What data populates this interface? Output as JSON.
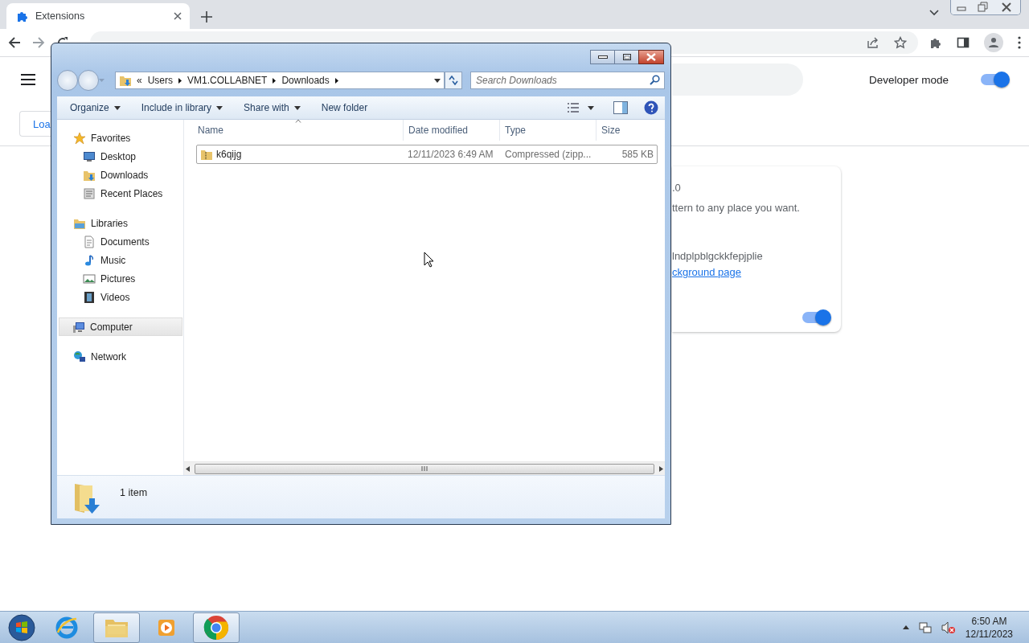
{
  "browser": {
    "tab": {
      "title": "Extensions",
      "selected": true
    }
  },
  "extensions_page": {
    "developer_mode": {
      "label": "Developer mode",
      "on": true
    },
    "load_button": "Loa",
    "card": {
      "version": ".0",
      "description": "ttern to any place you want.",
      "id": "lndplpblgckkfepjplie",
      "link": "ckground page",
      "enabled": true
    }
  },
  "explorer": {
    "breadcrumb_overflow": "«",
    "breadcrumb": [
      "Users",
      "VM1.COLLABNET",
      "Downloads"
    ],
    "search": {
      "placeholder": "Search Downloads"
    },
    "toolbar": [
      {
        "label": "Organize",
        "dropdown": true
      },
      {
        "label": "Include in library",
        "dropdown": true
      },
      {
        "label": "Share with",
        "dropdown": true
      },
      {
        "label": "New folder",
        "dropdown": false
      }
    ],
    "nav": [
      {
        "label": "Favorites",
        "kind": "star",
        "selected": false,
        "children": [
          {
            "label": "Desktop",
            "kind": "desktop",
            "selected": false
          },
          {
            "label": "Downloads",
            "kind": "downloads",
            "selected": false
          },
          {
            "label": "Recent Places",
            "kind": "recent",
            "selected": false
          }
        ]
      },
      {
        "label": "Libraries",
        "kind": "library",
        "selected": false,
        "children": [
          {
            "label": "Documents",
            "kind": "document",
            "selected": false
          },
          {
            "label": "Music",
            "kind": "music",
            "selected": false
          },
          {
            "label": "Pictures",
            "kind": "pictures",
            "selected": false
          },
          {
            "label": "Videos",
            "kind": "video",
            "selected": false
          }
        ]
      },
      {
        "label": "Computer",
        "kind": "computer",
        "selected": true
      },
      {
        "label": "Network",
        "kind": "network",
        "selected": false
      }
    ],
    "columns": [
      "Name",
      "Date modified",
      "Type",
      "Size"
    ],
    "files": [
      {
        "name": "k6qijg",
        "date": "12/11/2023 6:49 AM",
        "type": "Compressed (zipp...",
        "size": "585 KB",
        "selected": true
      }
    ],
    "status": "1 item"
  },
  "taskbar": {
    "apps": [
      {
        "kind": "ie",
        "active": false
      },
      {
        "kind": "folder",
        "active": true
      },
      {
        "kind": "media",
        "active": false
      },
      {
        "kind": "chrome",
        "active": true
      }
    ],
    "clock": {
      "time": "6:50 AM",
      "date": "12/11/2023"
    }
  }
}
